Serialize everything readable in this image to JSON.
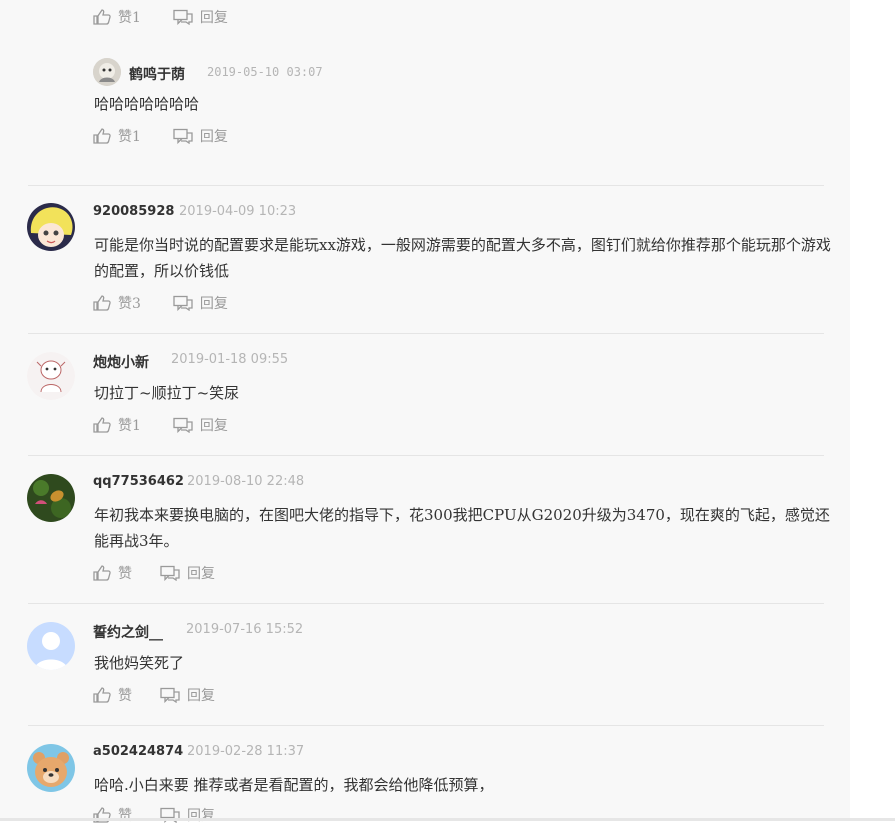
{
  "top_actions": {
    "like": "赞1",
    "reply": "回复"
  },
  "sub_reply": {
    "username": "鹤鸣于荫",
    "time": "2019-05-10 03:07",
    "text": "哈哈哈哈哈哈哈",
    "like": "赞1",
    "reply": "回复"
  },
  "comments": [
    {
      "username": "920085928",
      "time": "2019-04-09 10:23",
      "text": "可能是你当时说的配置要求是能玩xx游戏，一般网游需要的配置大多不高，图钉们就给你推荐那个能玩那个游戏的配置，所以价钱低",
      "like": "赞3",
      "reply": "回复"
    },
    {
      "username": "炮炮小新",
      "time": "2019-01-18 09:55",
      "text": "切拉丁~顺拉丁~笑尿",
      "like": "赞1",
      "reply": "回复"
    },
    {
      "username": "qq77536462",
      "time": "2019-08-10 22:48",
      "text": "年初我本来要换电脑的，在图吧大佬的指导下，花300我把CPU从G2020升级为3470，现在爽的飞起，感觉还能再战3年。",
      "like": "赞",
      "reply": "回复"
    },
    {
      "username": "誓约之剑__",
      "time": "2019-07-16 15:52",
      "text": "我他妈笑死了",
      "like": "赞",
      "reply": "回复"
    },
    {
      "username": "a502424874",
      "time": "2019-02-28 11:37",
      "text": "哈哈.小白来要 推荐或者是看配置的，我都会给他降低预算，",
      "like": "赞",
      "reply": "回复"
    }
  ],
  "colors": {
    "panel": "#f8f8f8",
    "divider": "#e5e5e5",
    "meta": "#b5b5b5",
    "icon": "#9a9a9a"
  }
}
